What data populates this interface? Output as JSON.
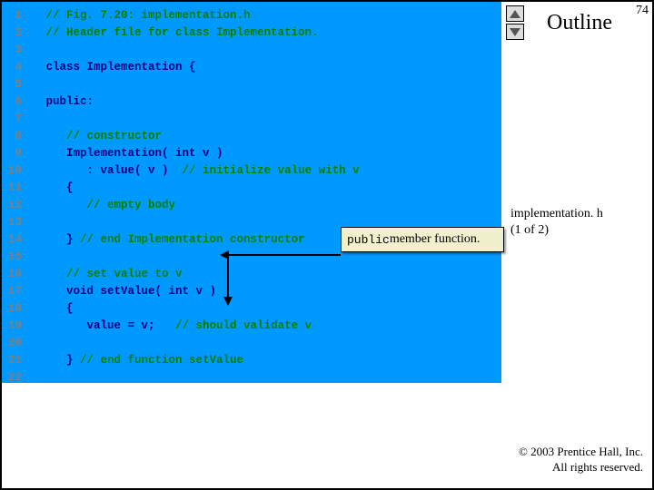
{
  "slide_number": "74",
  "outline_label": "Outline",
  "subtitle_line1": "implementation. h",
  "subtitle_line2": "(1 of 2)",
  "callout_mono": "public",
  "callout_rest": " member function.",
  "copyright_line1": "© 2003 Prentice Hall, Inc.",
  "copyright_line2": "All rights reserved.",
  "code": [
    {
      "n": "1",
      "seg": [
        [
          "comment",
          "// Fig. 7.20: implementation.h"
        ]
      ]
    },
    {
      "n": "2",
      "seg": [
        [
          "comment",
          "// Header file for class Implementation."
        ]
      ]
    },
    {
      "n": "3",
      "seg": [
        [
          "code",
          ""
        ]
      ]
    },
    {
      "n": "4",
      "seg": [
        [
          "code",
          "class Implementation {"
        ]
      ]
    },
    {
      "n": "5",
      "seg": [
        [
          "code",
          ""
        ]
      ]
    },
    {
      "n": "6",
      "seg": [
        [
          "code",
          "public:"
        ]
      ]
    },
    {
      "n": "7",
      "seg": [
        [
          "code",
          ""
        ]
      ]
    },
    {
      "n": "8",
      "seg": [
        [
          "comment",
          "   // constructor"
        ]
      ]
    },
    {
      "n": "9",
      "seg": [
        [
          "code",
          "   Implementation( int v ) "
        ]
      ]
    },
    {
      "n": "10",
      "seg": [
        [
          "code",
          "      : value( v )  "
        ],
        [
          "comment",
          "// initialize value with v"
        ]
      ]
    },
    {
      "n": "11",
      "seg": [
        [
          "code",
          "   { "
        ]
      ]
    },
    {
      "n": "12",
      "seg": [
        [
          "comment",
          "      // empty body"
        ]
      ]
    },
    {
      "n": "13",
      "seg": [
        [
          "code",
          ""
        ]
      ]
    },
    {
      "n": "14",
      "seg": [
        [
          "code",
          "   } "
        ],
        [
          "comment",
          "// end Implementation constructor"
        ]
      ]
    },
    {
      "n": "15",
      "seg": [
        [
          "code",
          ""
        ]
      ]
    },
    {
      "n": "16",
      "seg": [
        [
          "comment",
          "   // set value to v"
        ]
      ]
    },
    {
      "n": "17",
      "seg": [
        [
          "code",
          "   void setValue( int v ) "
        ]
      ]
    },
    {
      "n": "18",
      "seg": [
        [
          "code",
          "   { "
        ]
      ]
    },
    {
      "n": "19",
      "seg": [
        [
          "code",
          "      value = v;   "
        ],
        [
          "comment",
          "// should validate v"
        ]
      ]
    },
    {
      "n": "20",
      "seg": [
        [
          "code",
          ""
        ]
      ]
    },
    {
      "n": "21",
      "seg": [
        [
          "code",
          "   } "
        ],
        [
          "comment",
          "// end function setValue"
        ]
      ]
    },
    {
      "n": "22",
      "seg": [
        [
          "code",
          ""
        ]
      ]
    }
  ]
}
